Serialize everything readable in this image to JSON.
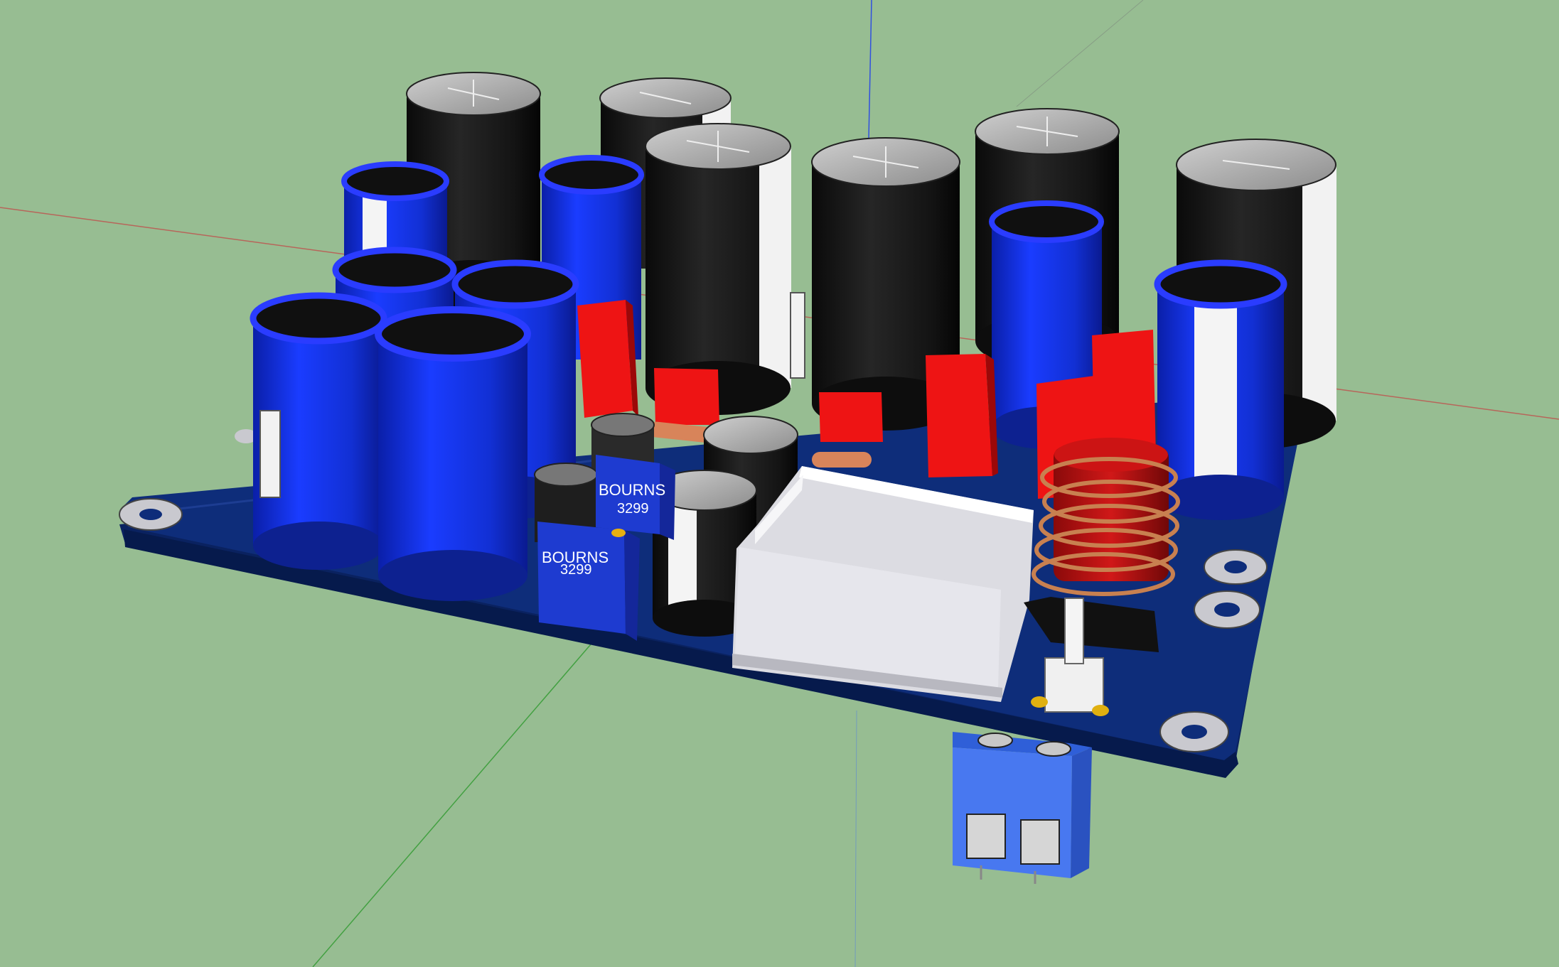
{
  "colors": {
    "viewport_bg": "#97bd92",
    "pcb": "#0c2a6e",
    "cap_blue": "#1433d6",
    "cap_black": "#161616",
    "film_red": "#ee1111",
    "pot_blue": "#1e3bd0",
    "terminal_blue": "#3f6ff0",
    "shield_white": "#e8e8ec"
  },
  "labels": {
    "pot_front_brand": "BOURNS",
    "pot_front_model": "3299",
    "pot_back_brand": "BOURNS",
    "pot_back_model": "3299"
  },
  "icons": [
    "axis-red-icon",
    "axis-green-icon",
    "axis-blue-icon"
  ]
}
